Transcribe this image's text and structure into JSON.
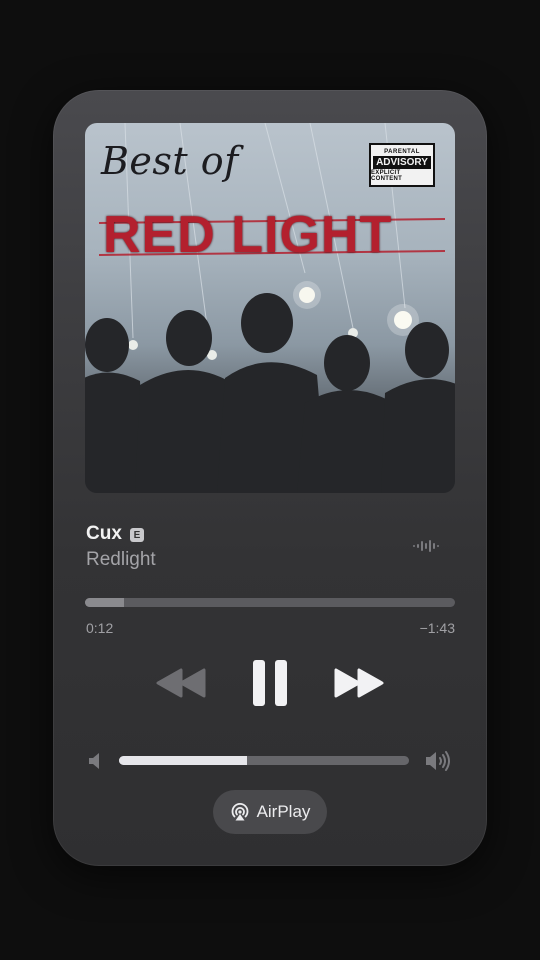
{
  "album": {
    "title_line1": "Best of",
    "title_line2": "RED LIGHT",
    "advisory": {
      "line1": "PARENTAL",
      "line2": "ADVISORY",
      "line3": "EXPLICIT CONTENT"
    }
  },
  "track": {
    "title": "Cux",
    "explicit_badge": "E",
    "artist": "Redlight"
  },
  "playback": {
    "elapsed": "0:12",
    "remaining": "−1:43",
    "progress_fraction": 0.105
  },
  "volume": {
    "level_fraction": 0.44
  },
  "airplay": {
    "label": "AirPlay"
  },
  "icons": {
    "rewind": "rewind-icon",
    "pause": "pause-icon",
    "fast_forward": "fast-forward-icon",
    "volume_low": "speaker-low-icon",
    "volume_high": "speaker-high-icon",
    "airplay": "airplay-icon",
    "waveform": "waveform-icon"
  },
  "colors": {
    "accent_red": "#b3202e",
    "card_bg": "#3a3a3d"
  }
}
